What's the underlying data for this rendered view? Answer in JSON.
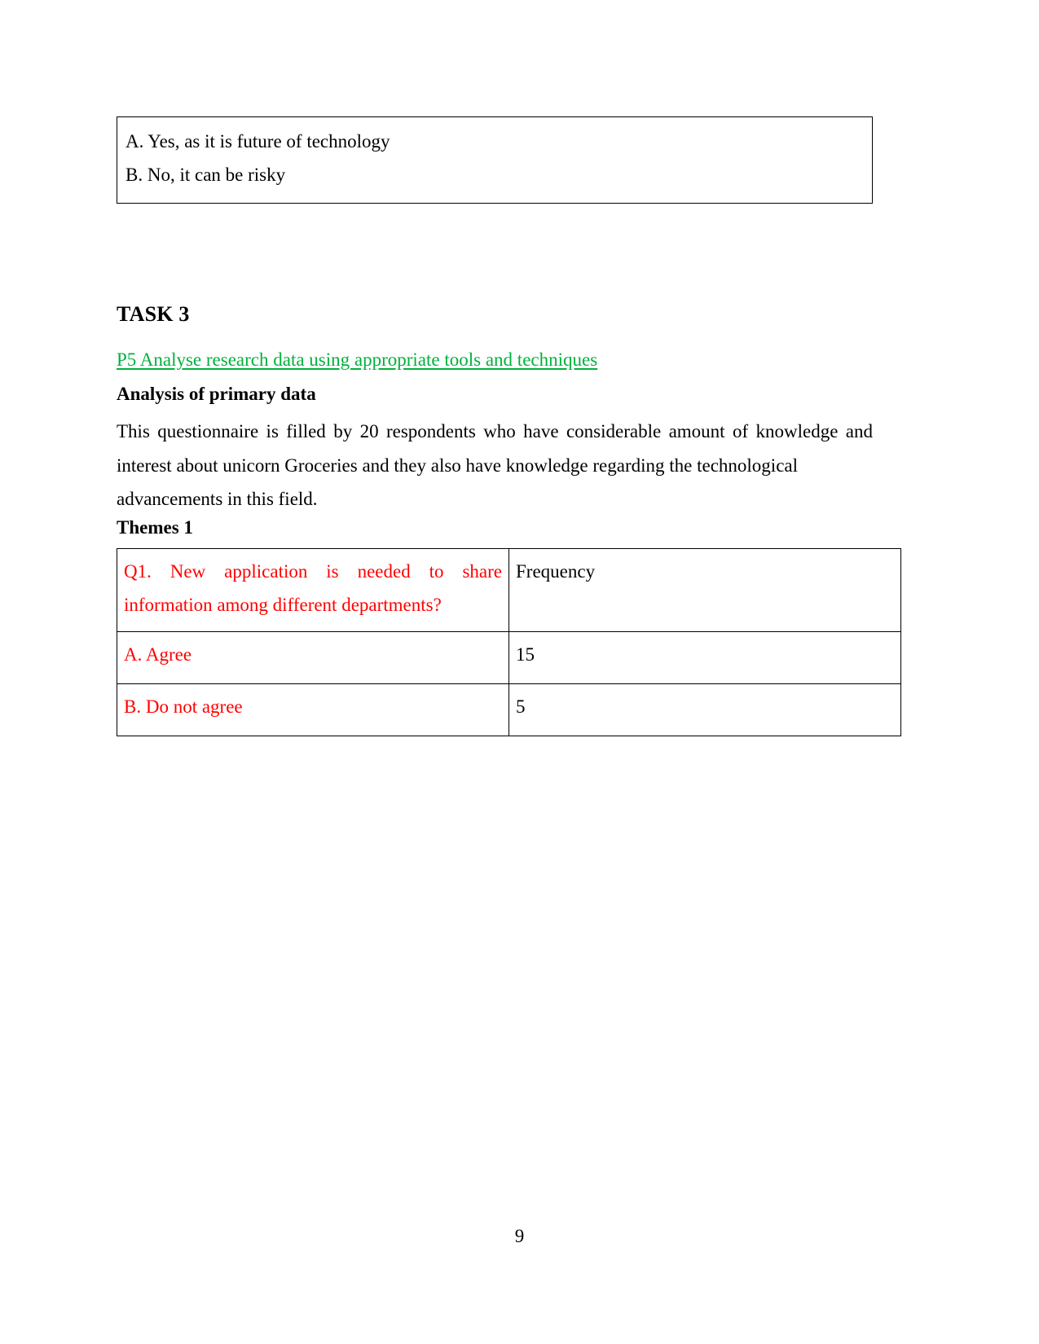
{
  "document": {
    "page_number": "9"
  },
  "options_table": {
    "options": [
      "A. Yes, as it is future of technology",
      "B. No, it can be risky"
    ]
  },
  "task": {
    "heading": "TASK 3",
    "criterion_link": "P5 Analyse research data using appropriate tools and techniques",
    "sub_heading": "Analysis of primary data",
    "paragraph_line_1": "This questionnaire is filled by 20 respondents who have considerable amount of knowledge and",
    "paragraph_line_2": "interest about unicorn Groceries and they also have knowledge regarding the technological",
    "paragraph_line_3": "advancements in this field.",
    "themes_heading": "Themes 1"
  },
  "data_table": {
    "question_line_1": "Q1. New application is needed to share",
    "question_line_2": "information among different departments?",
    "frequency_header": "Frequency",
    "rows": [
      {
        "option": "A. Agree",
        "frequency": "15"
      },
      {
        "option": "B. Do not agree",
        "frequency": "5"
      }
    ]
  },
  "colors": {
    "question_red": "#FF0000",
    "link_green": "#00B13C",
    "text_black": "#000000",
    "border_black": "#000000"
  }
}
